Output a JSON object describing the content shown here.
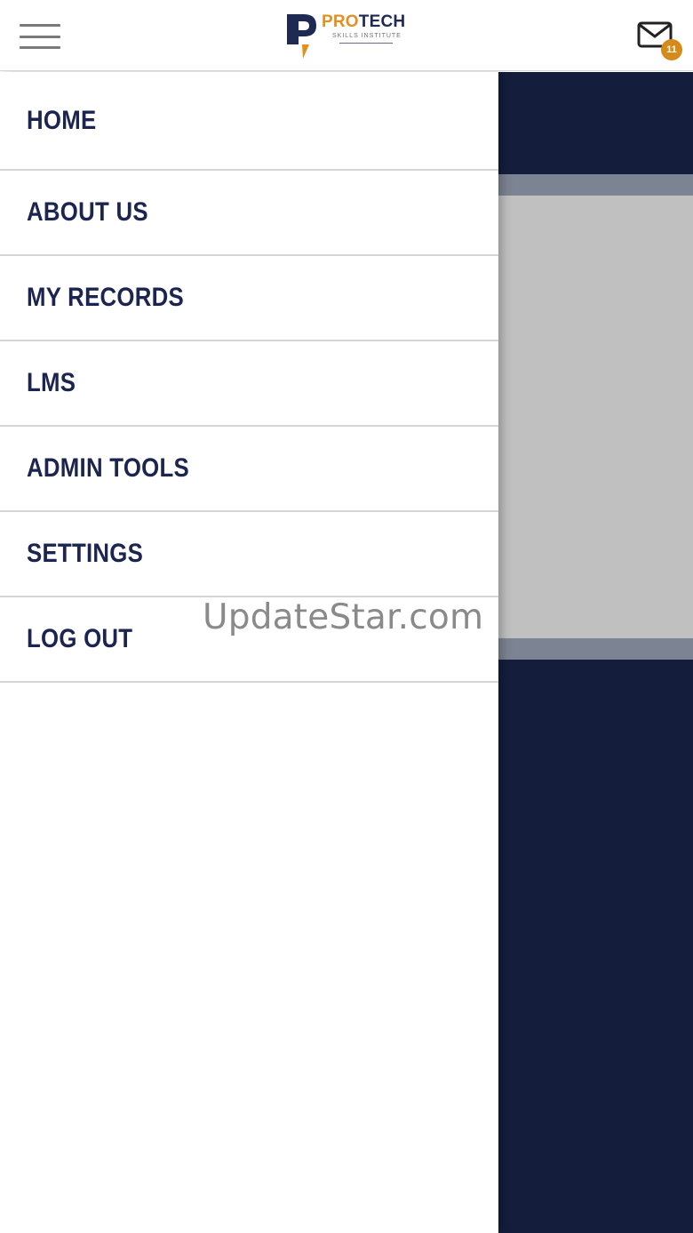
{
  "header": {
    "logo": {
      "brand_pro": "PRO",
      "brand_tech": "TECH",
      "tagline": "SKILLS INSTITUTE"
    },
    "mail": {
      "badge_count": "11"
    }
  },
  "menu": {
    "items": [
      {
        "label": "HOME"
      },
      {
        "label": "ABOUT US"
      },
      {
        "label": "MY RECORDS"
      },
      {
        "label": "LMS"
      },
      {
        "label": "ADMIN TOOLS"
      },
      {
        "label": "SETTINGS"
      },
      {
        "label": "LOG OUT"
      }
    ]
  },
  "watermark": "UpdateStar.com",
  "colors": {
    "navy": "#141e3c",
    "accent_orange": "#e2901e",
    "menu_text": "#1b2550",
    "card_gray": "#c0c0c0"
  },
  "icons": {
    "menu": "hamburger-icon",
    "mail": "mail-icon",
    "logo": "protech-logo-icon"
  }
}
